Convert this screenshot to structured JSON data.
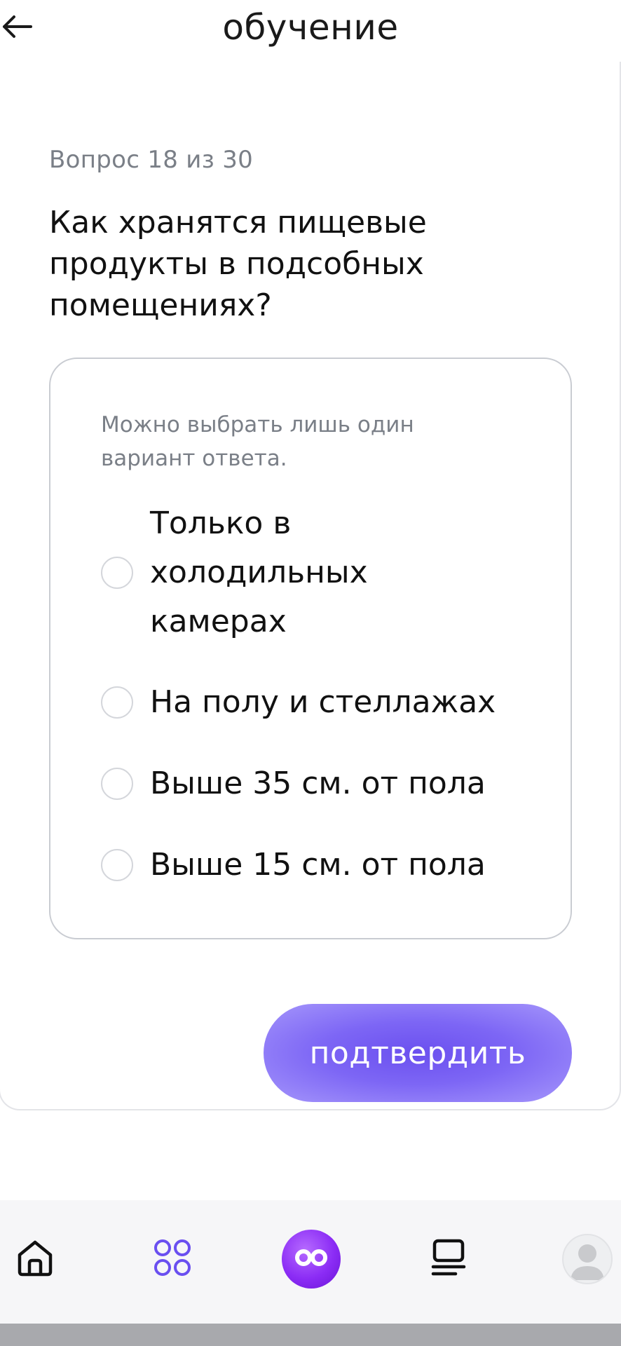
{
  "header": {
    "title": "обучение",
    "back_icon": "arrow-left-icon"
  },
  "question": {
    "counter": "Вопрос 18 из 30",
    "text": "Как хранятся пищевые продукты в подсобных помещениях?"
  },
  "options_box": {
    "hint": "Можно выбрать лишь один вариант ответа.",
    "options": [
      {
        "label": "Только в холодильных камерах",
        "selected": false
      },
      {
        "label": "На полу и стеллажах",
        "selected": false
      },
      {
        "label": "Выше 35 см. от пола",
        "selected": false
      },
      {
        "label": "Выше 15 см. от пола",
        "selected": false
      }
    ]
  },
  "confirm_button": {
    "label": "подтвердить",
    "color": "#6b50ef"
  },
  "bottom_nav": {
    "items": [
      {
        "icon": "home-icon"
      },
      {
        "icon": "grid-icon",
        "color": "#6a4ff0"
      },
      {
        "icon": "infinity-icon",
        "color": "#8b2cf5"
      },
      {
        "icon": "courses-icon"
      },
      {
        "icon": "avatar-icon"
      }
    ]
  }
}
